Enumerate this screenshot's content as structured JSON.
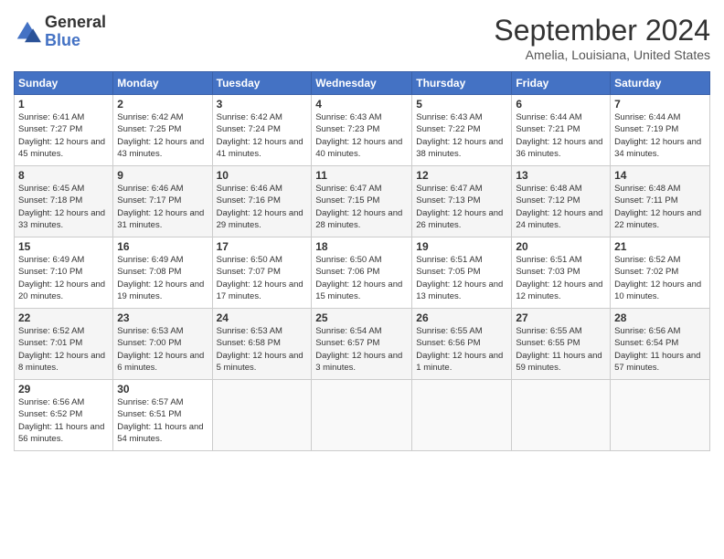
{
  "header": {
    "logo": {
      "line1": "General",
      "line2": "Blue"
    },
    "title": "September 2024",
    "location": "Amelia, Louisiana, United States"
  },
  "weekdays": [
    "Sunday",
    "Monday",
    "Tuesday",
    "Wednesday",
    "Thursday",
    "Friday",
    "Saturday"
  ],
  "weeks": [
    [
      {
        "day": "1",
        "sunrise": "6:41 AM",
        "sunset": "7:27 PM",
        "daylight": "12 hours and 45 minutes."
      },
      {
        "day": "2",
        "sunrise": "6:42 AM",
        "sunset": "7:25 PM",
        "daylight": "12 hours and 43 minutes."
      },
      {
        "day": "3",
        "sunrise": "6:42 AM",
        "sunset": "7:24 PM",
        "daylight": "12 hours and 41 minutes."
      },
      {
        "day": "4",
        "sunrise": "6:43 AM",
        "sunset": "7:23 PM",
        "daylight": "12 hours and 40 minutes."
      },
      {
        "day": "5",
        "sunrise": "6:43 AM",
        "sunset": "7:22 PM",
        "daylight": "12 hours and 38 minutes."
      },
      {
        "day": "6",
        "sunrise": "6:44 AM",
        "sunset": "7:21 PM",
        "daylight": "12 hours and 36 minutes."
      },
      {
        "day": "7",
        "sunrise": "6:44 AM",
        "sunset": "7:19 PM",
        "daylight": "12 hours and 34 minutes."
      }
    ],
    [
      {
        "day": "8",
        "sunrise": "6:45 AM",
        "sunset": "7:18 PM",
        "daylight": "12 hours and 33 minutes."
      },
      {
        "day": "9",
        "sunrise": "6:46 AM",
        "sunset": "7:17 PM",
        "daylight": "12 hours and 31 minutes."
      },
      {
        "day": "10",
        "sunrise": "6:46 AM",
        "sunset": "7:16 PM",
        "daylight": "12 hours and 29 minutes."
      },
      {
        "day": "11",
        "sunrise": "6:47 AM",
        "sunset": "7:15 PM",
        "daylight": "12 hours and 28 minutes."
      },
      {
        "day": "12",
        "sunrise": "6:47 AM",
        "sunset": "7:13 PM",
        "daylight": "12 hours and 26 minutes."
      },
      {
        "day": "13",
        "sunrise": "6:48 AM",
        "sunset": "7:12 PM",
        "daylight": "12 hours and 24 minutes."
      },
      {
        "day": "14",
        "sunrise": "6:48 AM",
        "sunset": "7:11 PM",
        "daylight": "12 hours and 22 minutes."
      }
    ],
    [
      {
        "day": "15",
        "sunrise": "6:49 AM",
        "sunset": "7:10 PM",
        "daylight": "12 hours and 20 minutes."
      },
      {
        "day": "16",
        "sunrise": "6:49 AM",
        "sunset": "7:08 PM",
        "daylight": "12 hours and 19 minutes."
      },
      {
        "day": "17",
        "sunrise": "6:50 AM",
        "sunset": "7:07 PM",
        "daylight": "12 hours and 17 minutes."
      },
      {
        "day": "18",
        "sunrise": "6:50 AM",
        "sunset": "7:06 PM",
        "daylight": "12 hours and 15 minutes."
      },
      {
        "day": "19",
        "sunrise": "6:51 AM",
        "sunset": "7:05 PM",
        "daylight": "12 hours and 13 minutes."
      },
      {
        "day": "20",
        "sunrise": "6:51 AM",
        "sunset": "7:03 PM",
        "daylight": "12 hours and 12 minutes."
      },
      {
        "day": "21",
        "sunrise": "6:52 AM",
        "sunset": "7:02 PM",
        "daylight": "12 hours and 10 minutes."
      }
    ],
    [
      {
        "day": "22",
        "sunrise": "6:52 AM",
        "sunset": "7:01 PM",
        "daylight": "12 hours and 8 minutes."
      },
      {
        "day": "23",
        "sunrise": "6:53 AM",
        "sunset": "7:00 PM",
        "daylight": "12 hours and 6 minutes."
      },
      {
        "day": "24",
        "sunrise": "6:53 AM",
        "sunset": "6:58 PM",
        "daylight": "12 hours and 5 minutes."
      },
      {
        "day": "25",
        "sunrise": "6:54 AM",
        "sunset": "6:57 PM",
        "daylight": "12 hours and 3 minutes."
      },
      {
        "day": "26",
        "sunrise": "6:55 AM",
        "sunset": "6:56 PM",
        "daylight": "12 hours and 1 minute."
      },
      {
        "day": "27",
        "sunrise": "6:55 AM",
        "sunset": "6:55 PM",
        "daylight": "11 hours and 59 minutes."
      },
      {
        "day": "28",
        "sunrise": "6:56 AM",
        "sunset": "6:54 PM",
        "daylight": "11 hours and 57 minutes."
      }
    ],
    [
      {
        "day": "29",
        "sunrise": "6:56 AM",
        "sunset": "6:52 PM",
        "daylight": "11 hours and 56 minutes."
      },
      {
        "day": "30",
        "sunrise": "6:57 AM",
        "sunset": "6:51 PM",
        "daylight": "11 hours and 54 minutes."
      },
      null,
      null,
      null,
      null,
      null
    ]
  ]
}
